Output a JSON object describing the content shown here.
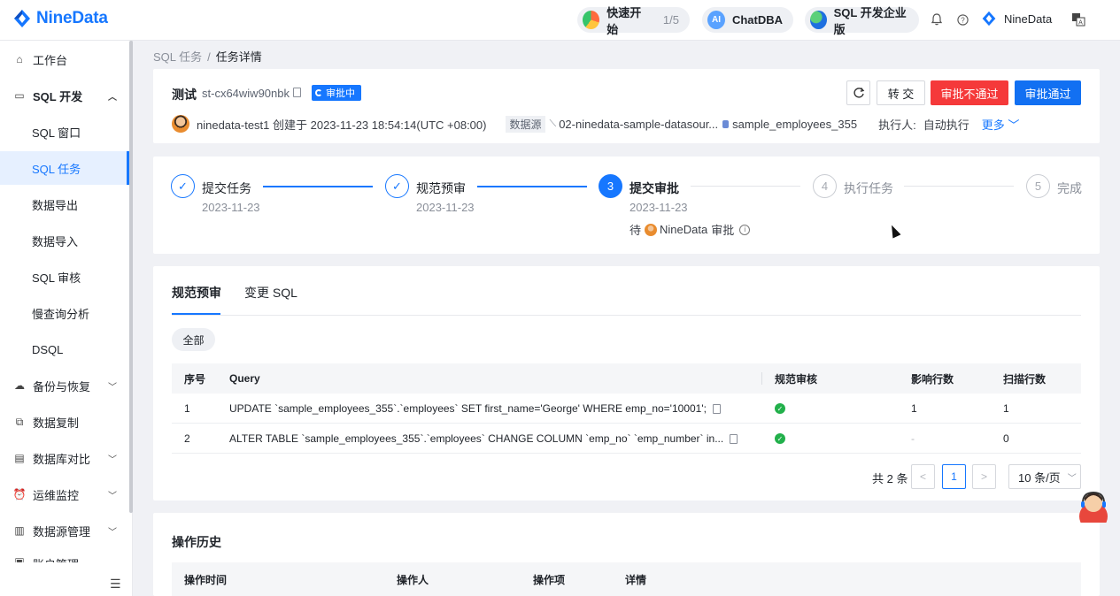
{
  "topbar": {
    "brand": "NineData",
    "quickstart_label": "快速开始",
    "quickstart_count": "1/5",
    "chatdba_label": "ChatDBA",
    "edition_label": "SQL 开发企业版",
    "user_name": "NineData",
    "accent": "#1677ff"
  },
  "sidebar": {
    "items": [
      {
        "label": "工作台",
        "icon": "home-icon"
      },
      {
        "label": "SQL 开发",
        "icon": "monitor-icon"
      },
      {
        "label": "SQL 窗口"
      },
      {
        "label": "SQL 任务"
      },
      {
        "label": "数据导出"
      },
      {
        "label": "数据导入"
      },
      {
        "label": "SQL 审核"
      },
      {
        "label": "慢查询分析"
      },
      {
        "label": "DSQL"
      },
      {
        "label": "备份与恢复",
        "icon": "backup-icon"
      },
      {
        "label": "数据复制",
        "icon": "replicate-icon"
      },
      {
        "label": "数据库对比",
        "icon": "compare-icon"
      },
      {
        "label": "运维监控",
        "icon": "alarm-icon"
      },
      {
        "label": "数据源管理",
        "icon": "datasource-icon"
      },
      {
        "label": "账户管理",
        "icon": "account-icon"
      }
    ]
  },
  "breadcrumb": {
    "parent": "SQL 任务",
    "separator": "/",
    "current": "任务详情"
  },
  "task": {
    "title": "测试",
    "id": "st-cx64wiw90nbk",
    "status": "审批中",
    "refresh_icon": "refresh-icon",
    "transfer_label": "转 交",
    "reject_label": "审批不通过",
    "approve_label": "审批通过",
    "reject_color": "#f5393a",
    "approve_color": "#1270f2",
    "creator_line": "ninedata-test1 创建于 2023-11-23 18:54:14(UTC +08:00)",
    "datasource_tag": "数据源",
    "datasource_name": "02-ninedata-sample-datasour...",
    "database_name": "sample_employees_355",
    "executor_label": "执行人:",
    "executor_value": "自动执行",
    "more_label": "更多"
  },
  "steps": [
    {
      "num": "✓",
      "title": "提交任务",
      "date": "2023-11-23",
      "state": "done"
    },
    {
      "num": "✓",
      "title": "规范预审",
      "date": "2023-11-23",
      "state": "done"
    },
    {
      "num": "3",
      "title": "提交审批",
      "date": "2023-11-23",
      "state": "current"
    },
    {
      "num": "4",
      "title": "执行任务",
      "date": "",
      "state": "waiting"
    },
    {
      "num": "5",
      "title": "完成",
      "date": "",
      "state": "waiting"
    }
  ],
  "approver": {
    "prefix": "待",
    "name": "NineData",
    "suffix": "审批"
  },
  "tabs": [
    {
      "label": "规范预审"
    },
    {
      "label": "变更 SQL"
    }
  ],
  "filter_label": "全部",
  "table": {
    "headers": [
      "序号",
      "Query",
      "规范审核",
      "影响行数",
      "扫描行数"
    ],
    "rows": [
      {
        "no": "1",
        "query": "UPDATE `sample_employees_355`.`employees` SET first_name='George' WHERE emp_no='10001';",
        "affected": "1",
        "scanned": "1"
      },
      {
        "no": "2",
        "query": "ALTER TABLE `sample_employees_355`.`employees` CHANGE COLUMN `emp_no` `emp_number` in...",
        "affected": "-",
        "scanned": "0"
      }
    ]
  },
  "pagination": {
    "total": "共 2 条",
    "prev": "<",
    "page": "1",
    "next": ">",
    "page_size": "10 条/页"
  },
  "history": {
    "title": "操作历史",
    "headers": [
      "操作时间",
      "操作人",
      "操作项",
      "详情"
    ]
  }
}
